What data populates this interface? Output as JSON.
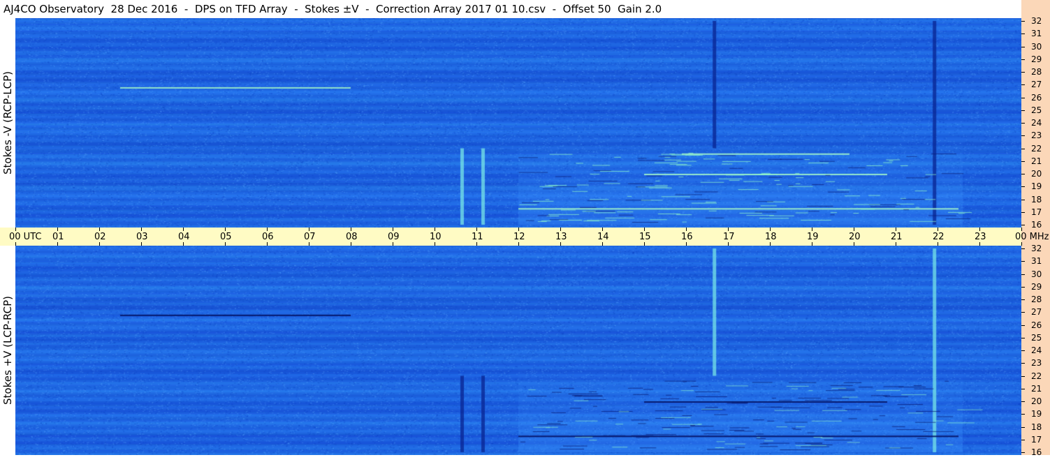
{
  "title": "AJ4CO Observatory  28 Dec 2016  -  DPS on TFD Array  -  Stokes ±V  -  Correction Array 2017 01 10.csv  -  Offset 50  Gain 2.0",
  "top_panel_label": "Stokes -V (RCP-LCP)",
  "bottom_panel_label": "Stokes +V (LCP-RCP)",
  "time_axis": {
    "labels": [
      "00 UTC",
      "01",
      "02",
      "03",
      "04",
      "05",
      "06",
      "07",
      "08",
      "09",
      "10",
      "11",
      "12",
      "13",
      "14",
      "15",
      "16",
      "17",
      "18",
      "19",
      "20",
      "21",
      "22",
      "23",
      "00 MHz"
    ]
  },
  "frequency_axis": {
    "labels": [
      "32",
      "31",
      "30",
      "29",
      "28",
      "27",
      "26",
      "25",
      "24",
      "23",
      "22",
      "21",
      "20",
      "19",
      "18",
      "17",
      "16"
    ]
  },
  "colors": {
    "background_blue": "#1f6ee6",
    "time_axis_bg": "#fffbc4",
    "freq_axis_bg": "#fbd7b8"
  },
  "chart_data": {
    "type": "heatmap",
    "title": "AJ4CO Observatory  28 Dec 2016  -  DPS on TFD Array  -  Stokes ±V  -  Correction Array 2017 01 10.csv  -  Offset 50  Gain 2.0",
    "xlabel": "UTC",
    "ylabel": "MHz",
    "xlim": [
      0,
      24
    ],
    "ylim": [
      16,
      32
    ],
    "panels": [
      {
        "name": "Stokes -V (RCP-LCP)",
        "features": [
          {
            "kind": "vertical_burst",
            "time_utc": 16.67,
            "freq_range": [
              22,
              32
            ],
            "polarity": "dark"
          },
          {
            "kind": "vertical_burst",
            "time_utc": 21.92,
            "freq_range": [
              16,
              32
            ],
            "polarity": "dark"
          },
          {
            "kind": "vertical_burst",
            "time_utc": 10.65,
            "freq_range": [
              16,
              22
            ],
            "polarity": "bright"
          },
          {
            "kind": "vertical_burst",
            "time_utc": 11.15,
            "freq_range": [
              16,
              22
            ],
            "polarity": "bright"
          },
          {
            "kind": "narrowband",
            "time_range": [
              2.5,
              8.0
            ],
            "freq_mhz": 26.8,
            "polarity": "bright"
          },
          {
            "kind": "narrowband",
            "time_range": [
              12.0,
              22.5
            ],
            "freq_mhz": 17.3,
            "polarity": "bright"
          },
          {
            "kind": "narrowband",
            "time_range": [
              15.9,
              19.9
            ],
            "freq_mhz": 21.6,
            "polarity": "bright"
          },
          {
            "kind": "narrowband",
            "time_range": [
              15.0,
              20.8
            ],
            "freq_mhz": 20.0,
            "polarity": "bright"
          }
        ]
      },
      {
        "name": "Stokes +V (LCP-RCP)",
        "features": [
          {
            "kind": "vertical_burst",
            "time_utc": 16.67,
            "freq_range": [
              22,
              32
            ],
            "polarity": "bright"
          },
          {
            "kind": "vertical_burst",
            "time_utc": 21.92,
            "freq_range": [
              16,
              32
            ],
            "polarity": "bright"
          },
          {
            "kind": "vertical_burst",
            "time_utc": 10.65,
            "freq_range": [
              16,
              22
            ],
            "polarity": "dark"
          },
          {
            "kind": "vertical_burst",
            "time_utc": 11.15,
            "freq_range": [
              16,
              22
            ],
            "polarity": "dark"
          },
          {
            "kind": "narrowband",
            "time_range": [
              2.5,
              8.0
            ],
            "freq_mhz": 26.8,
            "polarity": "dark"
          },
          {
            "kind": "narrowband",
            "time_range": [
              12.0,
              22.5
            ],
            "freq_mhz": 17.3,
            "polarity": "dark"
          },
          {
            "kind": "narrowband",
            "time_range": [
              15.0,
              20.8
            ],
            "freq_mhz": 20.0,
            "polarity": "dark"
          }
        ]
      }
    ]
  }
}
